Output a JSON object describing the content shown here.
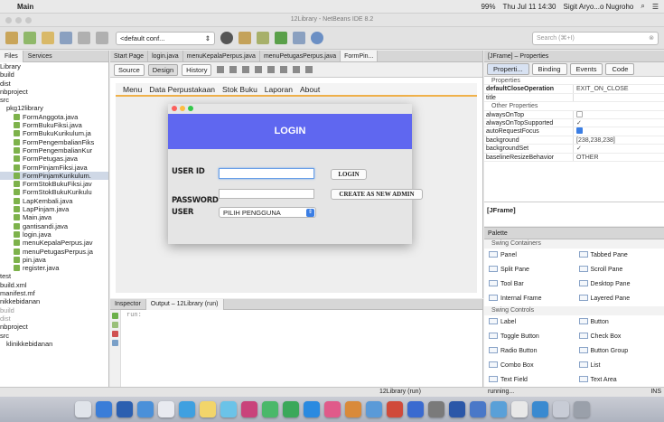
{
  "menubar": {
    "app_name": "Main",
    "battery": "99%",
    "clock": "Thu Jul 11  14:30",
    "user": "Sigit Aryo...o Nugroho"
  },
  "window": {
    "title": "12Library - NetBeans IDE 8.2"
  },
  "toolbar": {
    "config": "<default conf...",
    "search_placeholder": "Search (⌘+I)"
  },
  "left_panel": {
    "tabs": [
      "Files",
      "Services"
    ],
    "tree": [
      {
        "label": "Library",
        "cls": ""
      },
      {
        "label": "build",
        "cls": ""
      },
      {
        "label": "dist",
        "cls": ""
      },
      {
        "label": "nbproject",
        "cls": ""
      },
      {
        "label": "src",
        "cls": ""
      },
      {
        "label": "pkg12library",
        "cls": "ind1"
      },
      {
        "label": "FormAnggota.java",
        "cls": "ind2 file"
      },
      {
        "label": "FormBukuFiksi.java",
        "cls": "ind2 file"
      },
      {
        "label": "FormBukuKurikulum.ja",
        "cls": "ind2 file"
      },
      {
        "label": "FormPengembalianFiks",
        "cls": "ind2 file"
      },
      {
        "label": "FormPengembalianKur",
        "cls": "ind2 file"
      },
      {
        "label": "FormPetugas.java",
        "cls": "ind2 file"
      },
      {
        "label": "FormPinjamFiksi.java",
        "cls": "ind2 file"
      },
      {
        "label": "FormPinjamKurikulum.",
        "cls": "ind2 file sel"
      },
      {
        "label": "FormStokBukuFiksi.jav",
        "cls": "ind2 file"
      },
      {
        "label": "FormStokBukuKurikulu",
        "cls": "ind2 file"
      },
      {
        "label": "LapKembali.java",
        "cls": "ind2 file"
      },
      {
        "label": "LapPinjam.java",
        "cls": "ind2 file"
      },
      {
        "label": "Main.java",
        "cls": "ind2 file"
      },
      {
        "label": "gantisandi.java",
        "cls": "ind2 file"
      },
      {
        "label": "login.java",
        "cls": "ind2 file"
      },
      {
        "label": "menuKepalaPerpus.jav",
        "cls": "ind2 file"
      },
      {
        "label": "menuPetugasPerpus.ja",
        "cls": "ind2 file"
      },
      {
        "label": "pin.java",
        "cls": "ind2 file"
      },
      {
        "label": "register.java",
        "cls": "ind2 file"
      },
      {
        "label": "test",
        "cls": ""
      },
      {
        "label": "build.xml",
        "cls": ""
      },
      {
        "label": "manifest.mf",
        "cls": ""
      },
      {
        "label": "nikkebidanan",
        "cls": ""
      },
      {
        "label": "build",
        "cls": "grey"
      },
      {
        "label": "dist",
        "cls": "grey"
      },
      {
        "label": "nbproject",
        "cls": ""
      },
      {
        "label": "src",
        "cls": ""
      },
      {
        "label": "klinikkebidanan",
        "cls": "ind1"
      }
    ]
  },
  "editor": {
    "tabs": [
      "Start Page",
      "login.java",
      "menuKepalaPerpus.java",
      "menuPetugasPerpus.java",
      "FormPin..."
    ],
    "source_label": "Source",
    "design_label": "Design",
    "history_label": "History",
    "form_menu": [
      "Menu",
      "Data Perpustakaan",
      "Stok Buku",
      "Laporan",
      "About"
    ],
    "dialog": {
      "banner": "LOGIN",
      "user_id_label": "USER ID",
      "password_label": "PASSWORD",
      "user_label": "USER",
      "login_button": "LOGIN",
      "create_admin_button": "CREATE AS NEW ADMIN",
      "user_select": "PILIH PENGGUNA"
    }
  },
  "output": {
    "tabs": [
      "Inspector",
      "Output – 12Library (run)"
    ],
    "text": "run:"
  },
  "properties": {
    "tab_title": "[JFrame] – Properties",
    "buttons": [
      "Properti...",
      "Binding",
      "Events",
      "Code"
    ],
    "rows": [
      {
        "k": "Properties",
        "v": "",
        "type": "cat"
      },
      {
        "k": "defaultCloseOperation",
        "v": "EXIT_ON_CLOSE",
        "type": "bold"
      },
      {
        "k": "title",
        "v": "",
        "type": ""
      },
      {
        "k": "Other Properties",
        "v": "",
        "type": "cat"
      },
      {
        "k": "alwaysOnTop",
        "v": "",
        "type": "chk"
      },
      {
        "k": "alwaysOnTopSupported",
        "v": "✓",
        "type": ""
      },
      {
        "k": "autoRequestFocus",
        "v": "",
        "type": "chkon"
      },
      {
        "k": "background",
        "v": "[238,238,238]",
        "type": ""
      },
      {
        "k": "backgroundSet",
        "v": "✓",
        "type": ""
      },
      {
        "k": "baselineResizeBehavior",
        "v": "OTHER",
        "type": ""
      }
    ],
    "footer": "[JFrame]"
  },
  "palette": {
    "title": "Palette",
    "swing_containers": "Swing Containers",
    "containers": [
      "Panel",
      "Tabbed Pane",
      "Split Pane",
      "Scroll Pane",
      "Tool Bar",
      "Desktop Pane",
      "Internal Frame",
      "Layered Pane"
    ],
    "swing_controls": "Swing Controls",
    "controls": [
      "Label",
      "Button",
      "Toggle Button",
      "Check Box",
      "Radio Button",
      "Button Group",
      "Combo Box",
      "List",
      "Text Field",
      "Text Area",
      "Scroll Bar",
      "Slider"
    ]
  },
  "status": {
    "run": "12Library (run)",
    "running": "running...",
    "ins": "INS"
  },
  "colors": {
    "banner": "#5f67f0",
    "accent": "#3b7ee4",
    "menu_underline": "#f0b14a"
  }
}
